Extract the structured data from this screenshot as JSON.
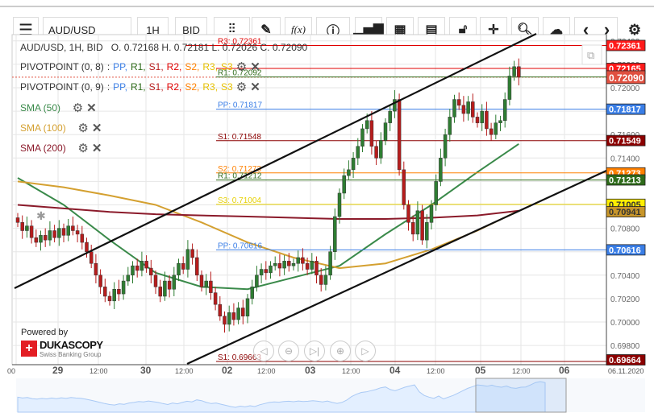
{
  "toolbar": {
    "menu_icon": "hamburger-icon",
    "symbol": "AUD/USD",
    "period": "1H",
    "side": "BID",
    "fx_label": "f(x)",
    "prev": "‹",
    "next": "›"
  },
  "header": {
    "ohlc": "AUD/USD, 1H, BID   O. 0.72168 H. 0.72181 L. 0.72026 C. 0.72090"
  },
  "indicators": {
    "pivot8": {
      "name": "PIVOTPOINT (0, 8)",
      "sep": ":",
      "items": [
        "PP,",
        "R1,",
        "S1,",
        "R2,",
        "S2,",
        "R3,",
        "S3"
      ]
    },
    "pivot9": {
      "name": "PIVOTPOINT (0, 9)",
      "sep": ":",
      "items": [
        "PP,",
        "R1,",
        "S1,",
        "R2,",
        "S2,",
        "R3,",
        "S3"
      ]
    },
    "sma50": "SMA (50)",
    "sma100": "SMA (100)",
    "sma200": "SMA (200)"
  },
  "colors": {
    "up": "#2e7d32",
    "down": "#b71c1c",
    "pp": "#3a7ee6",
    "r1": "#2e6b1a",
    "s1": "#8b0000",
    "r2": "#e00000",
    "s2": "#ff8000",
    "r3": "#e00000",
    "s3": "#e6d000",
    "sma50": "#3a8a4a",
    "sma100": "#d4a030",
    "sma200": "#8b1a2a"
  },
  "pivot_labels": [
    {
      "text": "R3: 0.72361",
      "price": 0.72361,
      "color": "#e00000"
    },
    {
      "text": "R1: 0.72092",
      "price": 0.72092,
      "color": "#2e6b1a"
    },
    {
      "text": "PP: 0.71817",
      "price": 0.71817,
      "color": "#3a7ee6"
    },
    {
      "text": "S1: 0.71548",
      "price": 0.71548,
      "color": "#8b0000"
    },
    {
      "text": "S2: 0.71273",
      "price": 0.71273,
      "color": "#ff8000"
    },
    {
      "text": "R1: 0.71212",
      "price": 0.71212,
      "color": "#2e6b1a"
    },
    {
      "text": "S3: 0.71004",
      "price": 0.71004,
      "color": "#e6d000"
    },
    {
      "text": "PP: 0.70616",
      "price": 0.70616,
      "color": "#3a7ee6"
    },
    {
      "text": "S1: 0.69663",
      "price": 0.69663,
      "color": "#8b0000"
    }
  ],
  "chart_data": {
    "type": "candlestick",
    "symbol": "AUD/USD",
    "timeframe": "1H",
    "ylim": [
      0.697,
      0.7245
    ],
    "y_ticks": [
      "0.72400",
      "0.72200",
      "0.72000",
      "0.71800",
      "0.71600",
      "0.71400",
      "0.71200",
      "0.71000",
      "0.70800",
      "0.70600",
      "0.70400",
      "0.70200",
      "0.70000",
      "0.69800"
    ],
    "x_ticks": [
      {
        "t": "00",
        "major": false
      },
      {
        "t": "29",
        "major": true
      },
      {
        "t": "12:00",
        "major": false
      },
      {
        "t": "30",
        "major": true
      },
      {
        "t": "12:00",
        "major": false
      },
      {
        "t": "02",
        "major": true
      },
      {
        "t": "12:00",
        "major": false
      },
      {
        "t": "03",
        "major": true
      },
      {
        "t": "12:00",
        "major": false
      },
      {
        "t": "04",
        "major": true
      },
      {
        "t": "12:00",
        "major": false
      },
      {
        "t": "05",
        "major": true
      },
      {
        "t": "12:00",
        "major": false
      },
      {
        "t": "06",
        "major": true
      }
    ],
    "x_end_label": "06.11.2020",
    "closes": [
      0.7085,
      0.7078,
      0.7082,
      0.7072,
      0.7068,
      0.7074,
      0.707,
      0.7078,
      0.7072,
      0.708,
      0.7074,
      0.7082,
      0.7078,
      0.7075,
      0.7068,
      0.706,
      0.705,
      0.704,
      0.703,
      0.7022,
      0.7018,
      0.7028,
      0.7024,
      0.7035,
      0.704,
      0.7048,
      0.7044,
      0.7052,
      0.7046,
      0.704,
      0.703,
      0.7022,
      0.7035,
      0.7028,
      0.704,
      0.705,
      0.7045,
      0.7062,
      0.7055,
      0.704,
      0.703,
      0.7035,
      0.7025,
      0.7015,
      0.7005,
      0.6998,
      0.7008,
      0.7002,
      0.7012,
      0.7005,
      0.702,
      0.703,
      0.704,
      0.7045,
      0.7042,
      0.7048,
      0.705,
      0.7046,
      0.7052,
      0.7048,
      0.705,
      0.7055,
      0.705,
      0.7045,
      0.7052,
      0.704,
      0.7032,
      0.704,
      0.706,
      0.709,
      0.711,
      0.7125,
      0.713,
      0.714,
      0.715,
      0.7165,
      0.7172,
      0.715,
      0.714,
      0.7155,
      0.717,
      0.718,
      0.719,
      0.713,
      0.71,
      0.7085,
      0.7075,
      0.7095,
      0.707,
      0.7085,
      0.71,
      0.712,
      0.714,
      0.716,
      0.7175,
      0.719,
      0.7185,
      0.7178,
      0.7188,
      0.7175,
      0.717,
      0.718,
      0.7165,
      0.716,
      0.717,
      0.7172,
      0.719,
      0.721,
      0.7218,
      0.7209
    ],
    "sma_index": [
      0,
      10,
      20,
      30,
      40,
      50,
      60,
      70,
      80,
      90,
      100,
      109
    ],
    "series": [
      {
        "name": "SMA (50)",
        "values": [
          0.7123,
          0.71,
          0.707,
          0.7042,
          0.703,
          0.7028,
          0.7038,
          0.7048,
          0.7075,
          0.71,
          0.7128,
          0.7152
        ]
      },
      {
        "name": "SMA (100)",
        "values": [
          0.712,
          0.7115,
          0.7108,
          0.71,
          0.7085,
          0.7068,
          0.7055,
          0.7046,
          0.705,
          0.7062,
          0.7078,
          0.7095
        ]
      },
      {
        "name": "SMA (200)",
        "values": [
          0.71,
          0.7097,
          0.7094,
          0.7092,
          0.7091,
          0.709,
          0.7089,
          0.7088,
          0.7088,
          0.7089,
          0.7091,
          0.7095
        ]
      }
    ],
    "price_tags": [
      {
        "text": "0.72361",
        "price": 0.72361,
        "bg": "#ff1a1a"
      },
      {
        "text": "0.72165",
        "price": 0.72165,
        "bg": "#ff1a1a"
      },
      {
        "text": "0.72090",
        "price": 0.7209,
        "bg": "#e05040",
        "big": true
      },
      {
        "text": "0.71817",
        "price": 0.71817,
        "bg": "#3a7ee6"
      },
      {
        "text": "0.71549",
        "price": 0.71549,
        "bg": "#8b0000"
      },
      {
        "text": "0.71273",
        "price": 0.71273,
        "bg": "#ff8000"
      },
      {
        "text": "0.71213",
        "price": 0.71213,
        "bg": "#2e6b1a"
      },
      {
        "text": "0.71005",
        "price": 0.71005,
        "bg": "#ffee00",
        "fg": "#333"
      },
      {
        "text": "0.70941",
        "price": 0.70941,
        "bg": "#c8962a",
        "fg": "#333"
      },
      {
        "text": "0.70616",
        "price": 0.70616,
        "bg": "#3a7ee6"
      },
      {
        "text": "0.69664",
        "price": 0.69664,
        "bg": "#8b0000"
      }
    ]
  },
  "branding": {
    "powered_by": "Powered by",
    "brand": "DUKASCOPY",
    "tagline": "Swiss Banking Group"
  }
}
